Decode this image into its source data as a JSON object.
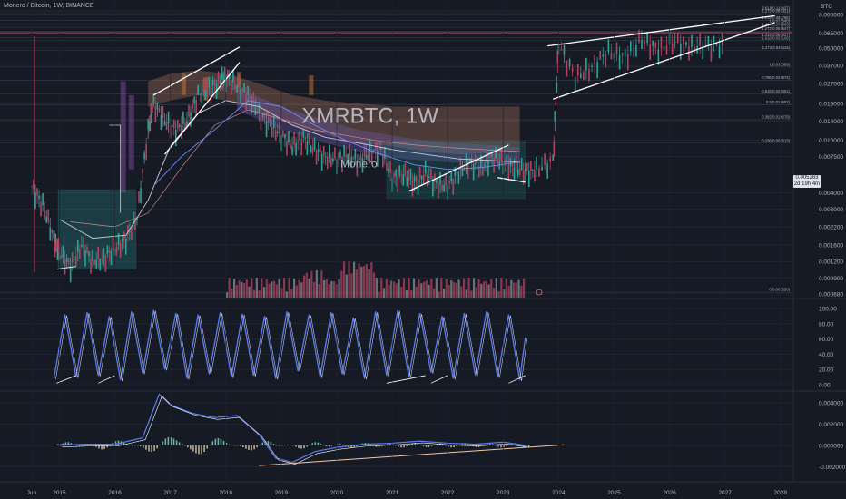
{
  "header": {
    "symbol_line": "Monero / Bitcoin, 1W, BINANCE",
    "currency": "BTC"
  },
  "watermark": "XMRBTC, 1W",
  "watermark_sub": "Monero",
  "last_price": {
    "value": "0.005263",
    "sub": "2d 19h 4m"
  },
  "xaxis": {
    "labels": [
      "Jun",
      "2015",
      "2016",
      "2017",
      "2018",
      "2019",
      "2020",
      "2021",
      "2022",
      "2023",
      "2024",
      "2025",
      "2026",
      "2027",
      "2028"
    ]
  },
  "price_axis": {
    "labels": [
      "0.090000",
      "0.065000",
      "0.050000",
      "0.037000",
      "0.027000",
      "0.019000",
      "0.014000",
      "0.010000",
      "0.007500",
      "0.005263",
      "0.004000",
      "0.003000",
      "0.002200",
      "0.001600",
      "0.001200",
      "0.000900",
      "0.000680"
    ]
  },
  "fib_levels": [
    "2.618(0.118437)",
    "2.272(0.096321)",
    "1.618(0.080786)",
    "1.414(0.071883)",
    "1.272(0.066547)",
    "1(0.076545)",
    "1.618(0.057106)",
    "1.414(0.060027)",
    "1.272(0.048116)",
    "1(0.036069)",
    "0.786(0.028574)",
    "0.618(0.022451)",
    "0.5(0.018582)",
    "0.382(0.014279)",
    "0.236(0.009513)",
    "0(0.000550)"
  ],
  "osc_axis": {
    "labels": [
      "100.00",
      "80.00",
      "60.00",
      "40.00",
      "20.00",
      "0.00"
    ]
  },
  "macd_axis": {
    "labels": [
      "0.004000",
      "0.002000",
      "0.000000",
      "-0.002000"
    ]
  },
  "colors": {
    "bg": "#161a25",
    "grid": "#262b38",
    "candle": "#26a69a",
    "ma": "#c7cbd4",
    "osc": "#5b7cf0",
    "trend": "#ffffff",
    "box": "#49c9c0",
    "red": "#b2435f",
    "macd_up": "#7ec8b8",
    "macd_down": "#d7c6a8"
  },
  "chart_data": [
    {
      "type": "line",
      "title": "XMRBTC, 1W",
      "x": [
        2014.5,
        2014.7,
        2014.9,
        2015.0,
        2015.2,
        2015.4,
        2015.6,
        2015.8,
        2016.0,
        2016.2,
        2016.4,
        2016.6,
        2016.7,
        2016.9,
        2017.1,
        2017.3,
        2017.5,
        2017.7,
        2017.9,
        2018.0,
        2018.2,
        2018.4,
        2018.6,
        2018.8,
        2019.0,
        2019.2,
        2019.4,
        2019.6,
        2019.8,
        2020.0,
        2020.2,
        2020.4,
        2020.6,
        2020.8,
        2021.0,
        2021.2,
        2021.4,
        2021.6,
        2021.8,
        2022.0,
        2022.2,
        2022.4,
        2022.6,
        2022.8,
        2023.0,
        2023.2,
        2023.4,
        2023.6,
        2023.9,
        2024.0,
        2024.3,
        2024.6,
        2024.9,
        2025.2,
        2025.5,
        2025.8,
        2026.1,
        2026.4,
        2026.7,
        2027.0
      ],
      "y": [
        0.0045,
        0.0032,
        0.0018,
        0.0014,
        0.0011,
        0.0016,
        0.0012,
        0.0013,
        0.0015,
        0.0018,
        0.0026,
        0.012,
        0.019,
        0.014,
        0.012,
        0.014,
        0.022,
        0.025,
        0.028,
        0.031,
        0.026,
        0.022,
        0.016,
        0.013,
        0.011,
        0.009,
        0.0105,
        0.0085,
        0.0075,
        0.0072,
        0.0078,
        0.0069,
        0.0082,
        0.0085,
        0.0052,
        0.0055,
        0.0048,
        0.0056,
        0.0047,
        0.0045,
        0.0058,
        0.0068,
        0.0062,
        0.0075,
        0.0068,
        0.0062,
        0.0058,
        0.006,
        0.007,
        0.054,
        0.03,
        0.036,
        0.047,
        0.043,
        0.058,
        0.049,
        0.056,
        0.051,
        0.053,
        0.052
      ],
      "ylim": [
        0.00068,
        0.09
      ],
      "log_scale": true
    },
    {
      "type": "line",
      "title": "",
      "x": [
        2014.9,
        2015.1,
        2015.3,
        2015.5,
        2015.7,
        2015.9,
        2016.1,
        2016.3,
        2016.5,
        2016.7,
        2016.9,
        2017.1,
        2017.3,
        2017.5,
        2017.7,
        2017.9,
        2018.1,
        2018.3,
        2018.5,
        2018.7,
        2018.9,
        2019.1,
        2019.3,
        2019.5,
        2019.7,
        2019.9,
        2020.1,
        2020.3,
        2020.5,
        2020.7,
        2020.9,
        2021.1,
        2021.3,
        2021.5,
        2021.7,
        2021.9,
        2022.1,
        2022.3,
        2022.5,
        2022.7,
        2022.9,
        2023.1,
        2023.3,
        2023.4
      ],
      "y": [
        8,
        92,
        10,
        95,
        12,
        90,
        6,
        96,
        15,
        98,
        20,
        94,
        8,
        92,
        14,
        95,
        10,
        93,
        12,
        90,
        8,
        96,
        18,
        92,
        10,
        95,
        14,
        88,
        8,
        96,
        12,
        98,
        10,
        94,
        16,
        90,
        8,
        94,
        12,
        96,
        10,
        92,
        6,
        62
      ],
      "ylim": [
        0,
        100
      ]
    },
    {
      "type": "line",
      "title": "",
      "x": [
        2015.0,
        2015.5,
        2016.0,
        2016.5,
        2016.8,
        2017.0,
        2017.4,
        2017.8,
        2018.2,
        2018.6,
        2018.9,
        2019.2,
        2019.6,
        2020.0,
        2020.5,
        2021.0,
        2021.5,
        2022.0,
        2022.5,
        2023.0,
        2023.4
      ],
      "y": [
        0.0,
        0.0001,
        0.0001,
        0.0007,
        0.0048,
        0.0038,
        0.003,
        0.0026,
        0.0028,
        0.001,
        -0.0012,
        -0.0016,
        -0.0006,
        -0.0002,
        0.0001,
        0.0002,
        0.0004,
        0.0002,
        0.0001,
        0.0003,
        0.0
      ],
      "ylim": [
        -0.003,
        0.0045
      ]
    }
  ]
}
